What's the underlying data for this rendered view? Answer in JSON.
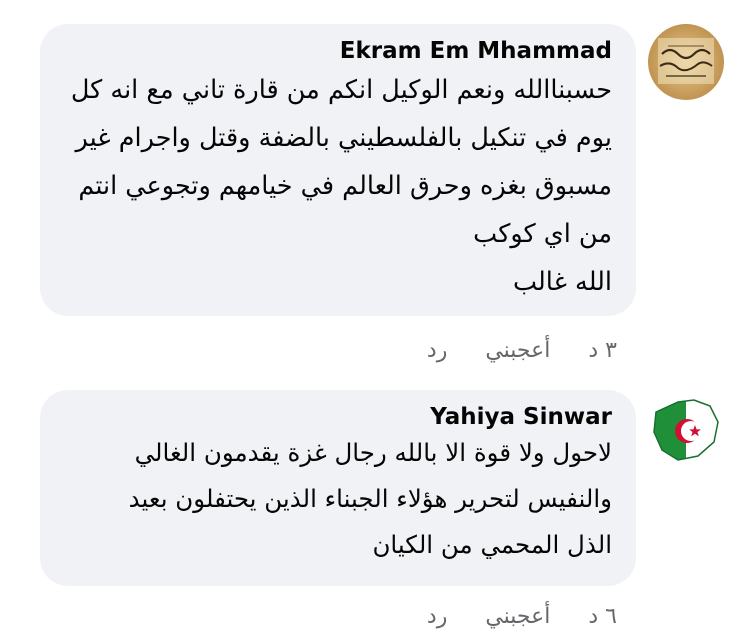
{
  "comments": [
    {
      "author": "Ekram Em Mhammad",
      "text": "حسبناالله ونعم الوكيل انكم من قارة تاني مع انه كل\nيوم في تنكيل بالفلسطيني بالضفة وقتل واجرام غير\nمسبوق بغزه وحرق العالم في خيامهم وتجوعي انتم\nمن اي كوكب\nالله غالب",
      "time": "٣ د",
      "like_label": "أعجبني",
      "reply_label": "رد",
      "avatar_icon": "calligraphy-avatar"
    },
    {
      "author": "Yahiya Sinwar",
      "text": "لاحول ولا قوة الا بالله رجال غزة يقدمون الغالي\nوالنفيس لتحرير هؤلاء الجبناء الذين يحتفلون بعيد\nالذل المحمي من الكيان",
      "time": "٦ د",
      "like_label": "أعجبني",
      "reply_label": "رد",
      "avatar_icon": "algeria-map-flag-avatar"
    }
  ],
  "colors": {
    "bubble_bg": "#f0f2f5",
    "meta_text": "#65676b",
    "text": "#050505"
  }
}
